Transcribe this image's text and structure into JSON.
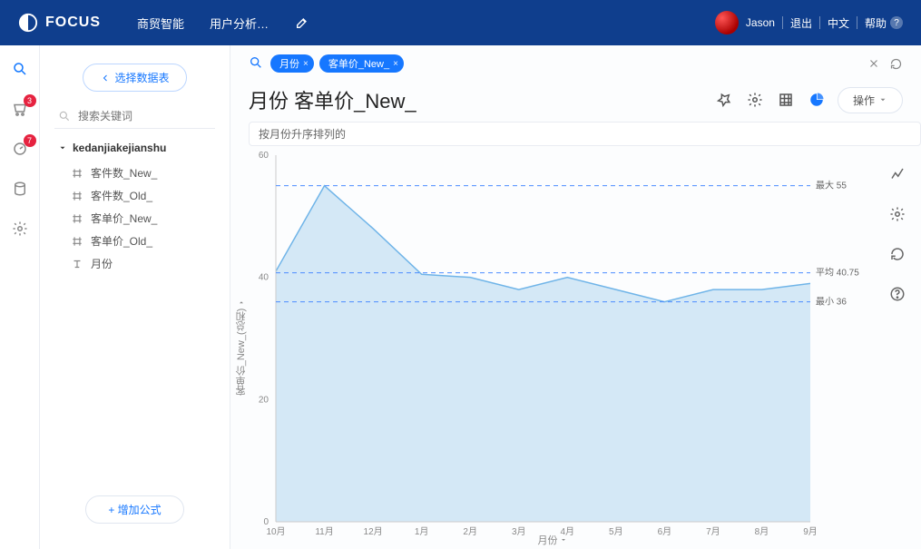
{
  "header": {
    "brand": "FOCUS",
    "nav": {
      "item0": "商贸智能",
      "item1": "用户分析…"
    },
    "user": "Jason",
    "logout": "退出",
    "lang": "中文",
    "help": "帮助"
  },
  "rail": {
    "badge0": "3",
    "badge1": "7"
  },
  "side": {
    "select_data_btn": "选择数据表",
    "search_placeholder": "搜索关键词",
    "group": "kedanjiakejianshu",
    "items": [
      "客件数_New_",
      "客件数_Old_",
      "客单价_New_",
      "客单价_Old_",
      "月份"
    ],
    "add_formula": "增加公式"
  },
  "search_bar": {
    "pills": [
      "月份",
      "客单价_New_"
    ]
  },
  "title_row": {
    "title": "月份 客单价_New_",
    "op_btn": "操作"
  },
  "sort_hint": "按月份升序排列的",
  "chart_data": {
    "type": "area",
    "title": "",
    "xlabel": "月份",
    "ylabel": "客单价_New_(总和)",
    "ylim": [
      0,
      60
    ],
    "yticks": [
      0,
      20,
      40,
      60
    ],
    "categories": [
      "10月",
      "11月",
      "12月",
      "1月",
      "2月",
      "3月",
      "4月",
      "5月",
      "6月",
      "7月",
      "8月",
      "9月"
    ],
    "values": [
      41,
      55,
      48,
      40.5,
      40,
      38,
      40,
      38,
      36,
      38,
      38,
      39
    ],
    "ref_lines": [
      {
        "label": "最大",
        "value": 55
      },
      {
        "label": "平均",
        "value": 40.75
      },
      {
        "label": "最小",
        "value": 36
      }
    ]
  }
}
